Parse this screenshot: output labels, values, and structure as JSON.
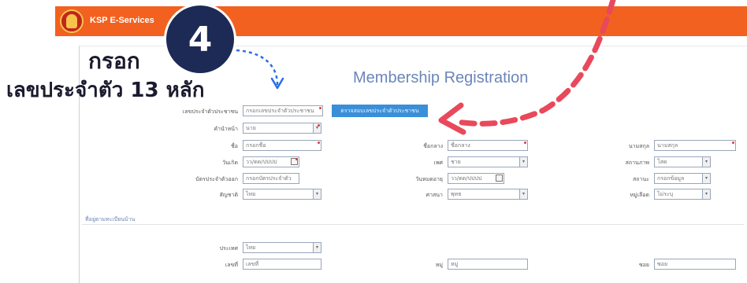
{
  "app": {
    "brand": "KSP E-Services",
    "page_title": "Membership Registration"
  },
  "annotation": {
    "step_number": "4",
    "line1": "กรอก",
    "line2": "เลขประจำตัว 13 หลัก"
  },
  "id_row": {
    "label": "เลขประจำตัวประชาชน",
    "value": "กรอกเลขประจำตัวประชาชน",
    "check_button": "ตรวจสอบเลขประจำตัวประชาชน"
  },
  "form": {
    "left": [
      {
        "label": "คำนำหน้า",
        "value": "นาย",
        "kind": "select"
      },
      {
        "label": "ชื่อ",
        "value": "กรอกชื่อ",
        "kind": "text"
      },
      {
        "label": "วันเกิด",
        "value": "วว/ดด/ปปปป",
        "kind": "date"
      },
      {
        "label": "บัตรประจำตัวออก",
        "value": "กรอกบัตรประจำตัว",
        "kind": "text"
      },
      {
        "label": "สัญชาติ",
        "value": "ไทย",
        "kind": "select"
      }
    ],
    "middle": [
      {
        "label": "ชื่อกลาง",
        "value": "ชื่อกลาง",
        "kind": "text"
      },
      {
        "label": "เพศ",
        "value": "ชาย",
        "kind": "select"
      },
      {
        "label": "วันหมดอายุ",
        "value": "วว/ดด/ปปปป",
        "kind": "date"
      },
      {
        "label": "ศาสนา",
        "value": "พุทธ",
        "kind": "select"
      }
    ],
    "right": [
      {
        "label": "นามสกุล",
        "value": "นามสกุล",
        "kind": "text"
      },
      {
        "label": "สถานภาพ",
        "value": "โสด",
        "kind": "select"
      },
      {
        "label": "สถานะ",
        "value": "กรอกข้อมูล",
        "kind": "select"
      },
      {
        "label": "หมู่เลือด",
        "value": "ไม่ระบุ",
        "kind": "select"
      }
    ]
  },
  "address_section": {
    "title": "ที่อยู่ตามทะเบียนบ้าน",
    "fields": [
      {
        "label": "ประเทศ",
        "value": "ไทย",
        "kind": "select"
      },
      {
        "label": "เลขที่",
        "value": "เลขที่",
        "kind": "text"
      },
      {
        "label": "หมู่",
        "value": "หมู่",
        "kind": "text"
      },
      {
        "label": "ซอย",
        "value": "ซอย",
        "kind": "text"
      }
    ]
  },
  "colors": {
    "topbar": "#f2611f",
    "arrow_red": "#e8495b",
    "arrow_blue": "#2a6ee8",
    "check_button": "#3a8fd8",
    "step_circle": "#1c2a55"
  }
}
